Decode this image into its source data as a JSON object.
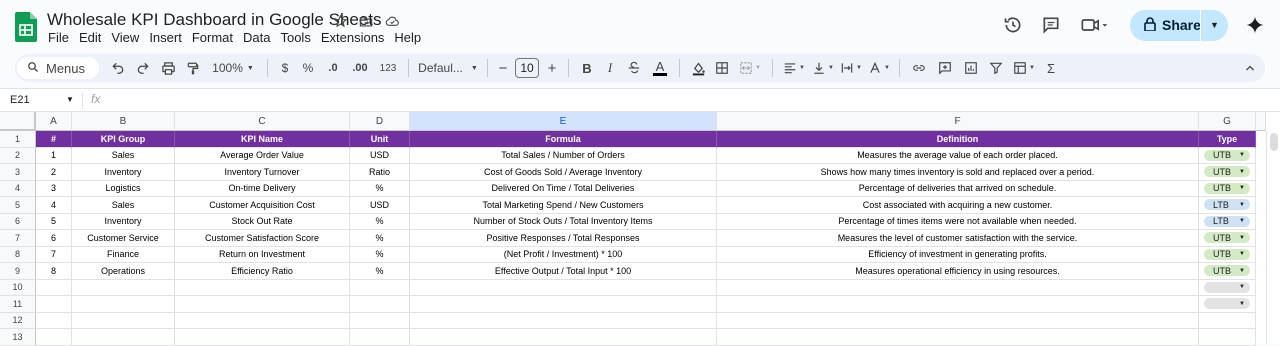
{
  "app": {
    "title": "Wholesale KPI Dashboard in Google Sheets",
    "menu": [
      "File",
      "Edit",
      "View",
      "Insert",
      "Format",
      "Data",
      "Tools",
      "Extensions",
      "Help"
    ],
    "share_label": "Share"
  },
  "toolbar": {
    "search_label": "Menus",
    "zoom": "100%",
    "currency": "$",
    "percent": "%",
    "dec_decrease": ".0",
    "dec_increase": ".00",
    "number_format": "123",
    "font": "Defaul...",
    "font_size": "10",
    "bold": "B",
    "italic": "I",
    "text_color": "A",
    "sigma": "Σ"
  },
  "formula_bar": {
    "cell_ref": "E21",
    "fx": "fx",
    "content": ""
  },
  "grid": {
    "columns": [
      "A",
      "B",
      "C",
      "D",
      "E",
      "F",
      "G"
    ],
    "selected_column": "E",
    "header": [
      "#",
      "KPI Group",
      "KPI Name",
      "Unit",
      "Formula",
      "Definition",
      "Type"
    ],
    "rows": [
      {
        "num": "1",
        "group": "Sales",
        "name": "Average Order Value",
        "unit": "USD",
        "formula": "Total Sales / Number of Orders",
        "definition": "Measures the average value of each order placed.",
        "type": "UTB"
      },
      {
        "num": "2",
        "group": "Inventory",
        "name": "Inventory Turnover",
        "unit": "Ratio",
        "formula": "Cost of Goods Sold / Average Inventory",
        "definition": "Shows how many times inventory is sold and replaced over a period.",
        "type": "UTB"
      },
      {
        "num": "3",
        "group": "Logistics",
        "name": "On-time Delivery",
        "unit": "%",
        "formula": "Delivered On Time / Total Deliveries",
        "definition": "Percentage of deliveries that arrived on schedule.",
        "type": "UTB"
      },
      {
        "num": "4",
        "group": "Sales",
        "name": "Customer Acquisition Cost",
        "unit": "USD",
        "formula": "Total Marketing Spend / New Customers",
        "definition": "Cost associated with acquiring a new customer.",
        "type": "LTB"
      },
      {
        "num": "5",
        "group": "Inventory",
        "name": "Stock Out Rate",
        "unit": "%",
        "formula": "Number of Stock Outs / Total Inventory Items",
        "definition": "Percentage of times items were not available when needed.",
        "type": "LTB"
      },
      {
        "num": "6",
        "group": "Customer Service",
        "name": "Customer Satisfaction Score",
        "unit": "%",
        "formula": "Positive Responses / Total Responses",
        "definition": "Measures the level of customer satisfaction with the service.",
        "type": "UTB"
      },
      {
        "num": "7",
        "group": "Finance",
        "name": "Return on Investment",
        "unit": "%",
        "formula": "(Net Profit / Investment) * 100",
        "definition": "Efficiency of investment in generating profits.",
        "type": "UTB"
      },
      {
        "num": "8",
        "group": "Operations",
        "name": "Efficiency Ratio",
        "unit": "%",
        "formula": "Effective Output / Total Input * 100",
        "definition": "Measures operational efficiency in using resources.",
        "type": "UTB"
      }
    ],
    "row_numbers": [
      "1",
      "2",
      "3",
      "4",
      "5",
      "6",
      "7",
      "8",
      "9",
      "10",
      "11",
      "12",
      "13"
    ]
  },
  "colors": {
    "header_fill": "#7030a0",
    "utb_chip": "#d4e9c5",
    "ltb_chip": "#cfe2f3",
    "share_button": "#c2e7ff",
    "sheets_green": "#0f9d58"
  }
}
